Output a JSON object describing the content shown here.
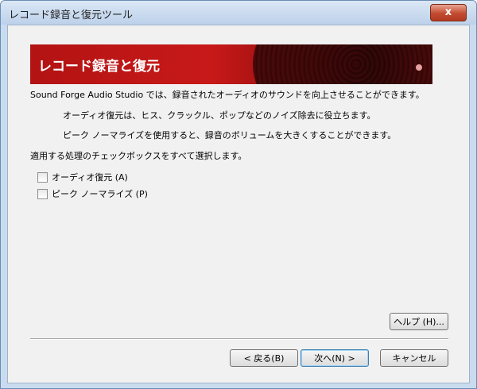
{
  "window": {
    "title": "レコード録音と復元ツール",
    "close_label": "x"
  },
  "banner": {
    "title": "レコード録音と復元"
  },
  "content": {
    "intro": "Sound Forge Audio Studio では、録音されたオーディオのサウンドを向上させることができます。",
    "bullet1": "オーディオ復元は、ヒス、クラックル、ポップなどのノイズ除去に役立ちます。",
    "bullet2": "ピーク ノーマライズを使用すると、録音のボリュームを大きくすることができます。",
    "instruction": "適用する処理のチェックボックスをすべて選択します。"
  },
  "checkboxes": [
    {
      "label": "オーディオ復元 (A)",
      "checked": false
    },
    {
      "label": "ピーク ノーマライズ (P)",
      "checked": false
    }
  ],
  "buttons": {
    "help": "ヘルプ (H)...",
    "back": "< 戻る(B)",
    "next": "次へ(N) >",
    "cancel": "キャンセル"
  }
}
